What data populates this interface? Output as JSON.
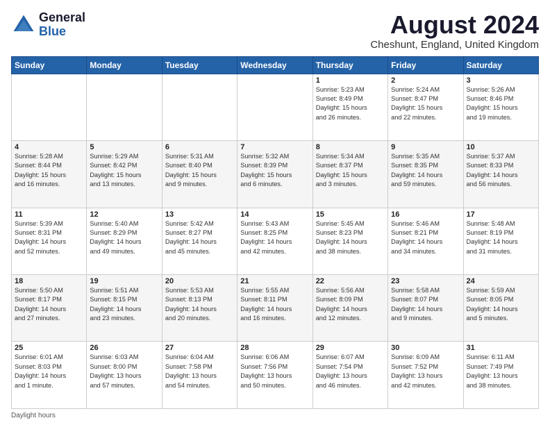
{
  "logo": {
    "text_general": "General",
    "text_blue": "Blue"
  },
  "header": {
    "title": "August 2024",
    "subtitle": "Cheshunt, England, United Kingdom"
  },
  "days_of_week": [
    "Sunday",
    "Monday",
    "Tuesday",
    "Wednesday",
    "Thursday",
    "Friday",
    "Saturday"
  ],
  "footer": {
    "daylight_note": "Daylight hours"
  },
  "weeks": [
    {
      "days": [
        {
          "num": "",
          "info": ""
        },
        {
          "num": "",
          "info": ""
        },
        {
          "num": "",
          "info": ""
        },
        {
          "num": "",
          "info": ""
        },
        {
          "num": "1",
          "info": "Sunrise: 5:23 AM\nSunset: 8:49 PM\nDaylight: 15 hours\nand 26 minutes."
        },
        {
          "num": "2",
          "info": "Sunrise: 5:24 AM\nSunset: 8:47 PM\nDaylight: 15 hours\nand 22 minutes."
        },
        {
          "num": "3",
          "info": "Sunrise: 5:26 AM\nSunset: 8:46 PM\nDaylight: 15 hours\nand 19 minutes."
        }
      ]
    },
    {
      "days": [
        {
          "num": "4",
          "info": "Sunrise: 5:28 AM\nSunset: 8:44 PM\nDaylight: 15 hours\nand 16 minutes."
        },
        {
          "num": "5",
          "info": "Sunrise: 5:29 AM\nSunset: 8:42 PM\nDaylight: 15 hours\nand 13 minutes."
        },
        {
          "num": "6",
          "info": "Sunrise: 5:31 AM\nSunset: 8:40 PM\nDaylight: 15 hours\nand 9 minutes."
        },
        {
          "num": "7",
          "info": "Sunrise: 5:32 AM\nSunset: 8:39 PM\nDaylight: 15 hours\nand 6 minutes."
        },
        {
          "num": "8",
          "info": "Sunrise: 5:34 AM\nSunset: 8:37 PM\nDaylight: 15 hours\nand 3 minutes."
        },
        {
          "num": "9",
          "info": "Sunrise: 5:35 AM\nSunset: 8:35 PM\nDaylight: 14 hours\nand 59 minutes."
        },
        {
          "num": "10",
          "info": "Sunrise: 5:37 AM\nSunset: 8:33 PM\nDaylight: 14 hours\nand 56 minutes."
        }
      ]
    },
    {
      "days": [
        {
          "num": "11",
          "info": "Sunrise: 5:39 AM\nSunset: 8:31 PM\nDaylight: 14 hours\nand 52 minutes."
        },
        {
          "num": "12",
          "info": "Sunrise: 5:40 AM\nSunset: 8:29 PM\nDaylight: 14 hours\nand 49 minutes."
        },
        {
          "num": "13",
          "info": "Sunrise: 5:42 AM\nSunset: 8:27 PM\nDaylight: 14 hours\nand 45 minutes."
        },
        {
          "num": "14",
          "info": "Sunrise: 5:43 AM\nSunset: 8:25 PM\nDaylight: 14 hours\nand 42 minutes."
        },
        {
          "num": "15",
          "info": "Sunrise: 5:45 AM\nSunset: 8:23 PM\nDaylight: 14 hours\nand 38 minutes."
        },
        {
          "num": "16",
          "info": "Sunrise: 5:46 AM\nSunset: 8:21 PM\nDaylight: 14 hours\nand 34 minutes."
        },
        {
          "num": "17",
          "info": "Sunrise: 5:48 AM\nSunset: 8:19 PM\nDaylight: 14 hours\nand 31 minutes."
        }
      ]
    },
    {
      "days": [
        {
          "num": "18",
          "info": "Sunrise: 5:50 AM\nSunset: 8:17 PM\nDaylight: 14 hours\nand 27 minutes."
        },
        {
          "num": "19",
          "info": "Sunrise: 5:51 AM\nSunset: 8:15 PM\nDaylight: 14 hours\nand 23 minutes."
        },
        {
          "num": "20",
          "info": "Sunrise: 5:53 AM\nSunset: 8:13 PM\nDaylight: 14 hours\nand 20 minutes."
        },
        {
          "num": "21",
          "info": "Sunrise: 5:55 AM\nSunset: 8:11 PM\nDaylight: 14 hours\nand 16 minutes."
        },
        {
          "num": "22",
          "info": "Sunrise: 5:56 AM\nSunset: 8:09 PM\nDaylight: 14 hours\nand 12 minutes."
        },
        {
          "num": "23",
          "info": "Sunrise: 5:58 AM\nSunset: 8:07 PM\nDaylight: 14 hours\nand 9 minutes."
        },
        {
          "num": "24",
          "info": "Sunrise: 5:59 AM\nSunset: 8:05 PM\nDaylight: 14 hours\nand 5 minutes."
        }
      ]
    },
    {
      "days": [
        {
          "num": "25",
          "info": "Sunrise: 6:01 AM\nSunset: 8:03 PM\nDaylight: 14 hours\nand 1 minute."
        },
        {
          "num": "26",
          "info": "Sunrise: 6:03 AM\nSunset: 8:00 PM\nDaylight: 13 hours\nand 57 minutes."
        },
        {
          "num": "27",
          "info": "Sunrise: 6:04 AM\nSunset: 7:58 PM\nDaylight: 13 hours\nand 54 minutes."
        },
        {
          "num": "28",
          "info": "Sunrise: 6:06 AM\nSunset: 7:56 PM\nDaylight: 13 hours\nand 50 minutes."
        },
        {
          "num": "29",
          "info": "Sunrise: 6:07 AM\nSunset: 7:54 PM\nDaylight: 13 hours\nand 46 minutes."
        },
        {
          "num": "30",
          "info": "Sunrise: 6:09 AM\nSunset: 7:52 PM\nDaylight: 13 hours\nand 42 minutes."
        },
        {
          "num": "31",
          "info": "Sunrise: 6:11 AM\nSunset: 7:49 PM\nDaylight: 13 hours\nand 38 minutes."
        }
      ]
    }
  ]
}
